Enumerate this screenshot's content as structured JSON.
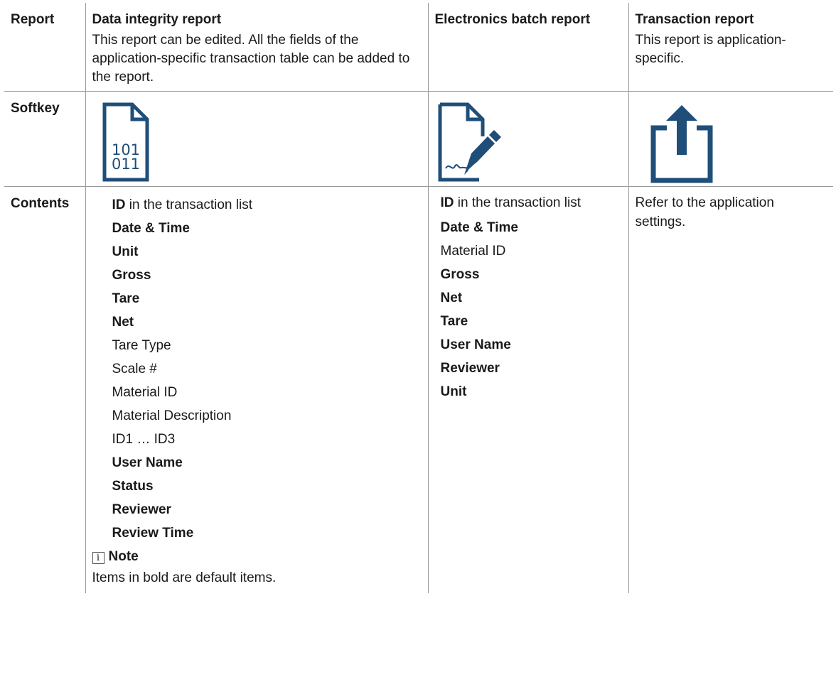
{
  "table": {
    "row_headers": {
      "report": "Report",
      "softkey": "Softkey",
      "contents": "Contents"
    },
    "columns": [
      {
        "title": "Data integrity report",
        "description": "This report can be edited. All the fields of the application-specific transaction table can be added to the report.",
        "icon": "binary-file-icon",
        "contents": [
          {
            "bold": "ID",
            "rest": " in the transaction list"
          },
          {
            "bold": "Date & Time",
            "rest": ""
          },
          {
            "bold": "Unit",
            "rest": ""
          },
          {
            "bold": "Gross",
            "rest": ""
          },
          {
            "bold": "Tare",
            "rest": ""
          },
          {
            "bold": "Net",
            "rest": ""
          },
          {
            "bold": "",
            "rest": "Tare Type"
          },
          {
            "bold": "",
            "rest": "Scale #"
          },
          {
            "bold": "",
            "rest": "Material ID"
          },
          {
            "bold": "",
            "rest": "Material Description"
          },
          {
            "bold": "",
            "rest": "ID1 … ID3"
          },
          {
            "bold": "User Name",
            "rest": ""
          },
          {
            "bold": "Status",
            "rest": ""
          },
          {
            "bold": "Reviewer",
            "rest": ""
          },
          {
            "bold": "Review Time",
            "rest": ""
          }
        ],
        "note_icon": "i",
        "note_title": "Note",
        "note_text": "Items in bold are default items."
      },
      {
        "title": "Electronics batch report",
        "description": "",
        "icon": "document-signature-icon",
        "contents": [
          {
            "bold": "ID",
            "rest": " in the transaction list"
          },
          {
            "bold": "Date & Time",
            "rest": ""
          },
          {
            "bold": "",
            "rest": "Material ID"
          },
          {
            "bold": "Gross",
            "rest": ""
          },
          {
            "bold": "Net",
            "rest": ""
          },
          {
            "bold": "Tare",
            "rest": ""
          },
          {
            "bold": "User Name",
            "rest": ""
          },
          {
            "bold": "Reviewer",
            "rest": ""
          },
          {
            "bold": "Unit",
            "rest": ""
          }
        ]
      },
      {
        "title": "Transaction report",
        "description": "This report is application-specific.",
        "icon": "export-upload-icon",
        "contents_text": "Refer to the application settings."
      }
    ],
    "icon_color": "#1f4e79"
  }
}
